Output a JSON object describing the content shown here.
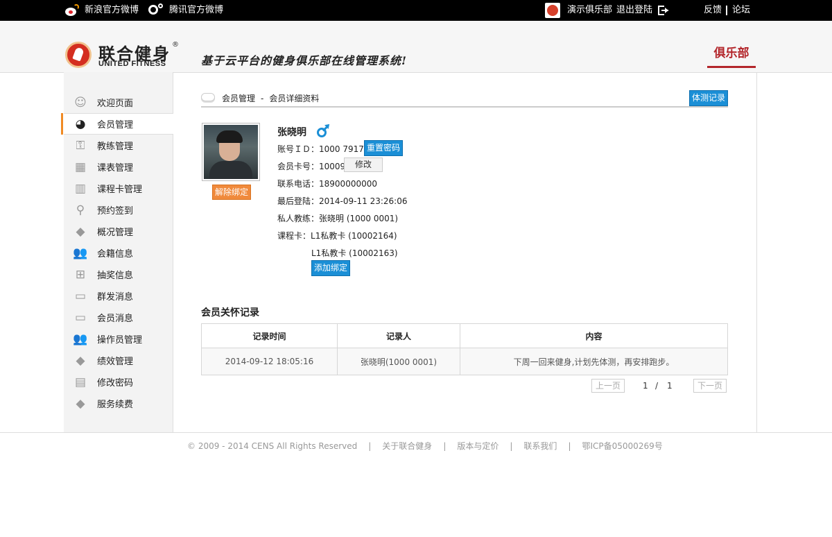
{
  "topbar": {
    "weibo": "新浪官方微博",
    "tencent": "腾讯官方微博",
    "club": "演示俱乐部",
    "logout": "退出登陆",
    "feedback": "反馈",
    "forum": "论坛"
  },
  "header": {
    "logo_cn": "联合健身",
    "logo_reg": "®",
    "logo_en": "UNITED FITNESS",
    "slogan": "基于云平台的健身俱乐部在线管理系统!",
    "tab": "俱乐部"
  },
  "sidebar": {
    "items": [
      {
        "label": "欢迎页面",
        "icon": "smile-icon"
      },
      {
        "label": "会员管理",
        "icon": "pacman-icon"
      },
      {
        "label": "教练管理",
        "icon": "lock-icon"
      },
      {
        "label": "课表管理",
        "icon": "calendar-icon"
      },
      {
        "label": "课程卡管理",
        "icon": "barcode-icon"
      },
      {
        "label": "预约签到",
        "icon": "location-pin-icon"
      },
      {
        "label": "概况管理",
        "icon": "diamond-icon"
      },
      {
        "label": "会籍信息",
        "icon": "users-icon"
      },
      {
        "label": "抽奖信息",
        "icon": "gift-icon"
      },
      {
        "label": "群发消息",
        "icon": "chat-icon"
      },
      {
        "label": "会员消息",
        "icon": "chat-icon"
      },
      {
        "label": "操作员管理",
        "icon": "users-icon"
      },
      {
        "label": "绩效管理",
        "icon": "diamond-icon"
      },
      {
        "label": "修改密码",
        "icon": "id-card-icon"
      },
      {
        "label": "服务续费",
        "icon": "diamond-icon"
      }
    ],
    "active_index": 1
  },
  "breadcrumb": {
    "level1": "会员管理",
    "separator": "-",
    "level2": "会员详细资料"
  },
  "body_test_button": "体测记录",
  "member": {
    "name": "张晓明",
    "unbind_button": "解除绑定",
    "account_label": "账号ＩＤ：",
    "account_value": "1000 7917",
    "reset_password_button": "重置密码",
    "card_label": "会员卡号：",
    "card_value": "10009",
    "modify_button": "修改",
    "phone_label": "联系电话：",
    "phone_value": "18900000000",
    "last_login_label": "最后登陆：",
    "last_login_value": "2014-09-11 23:26:06",
    "trainer_label": "私人教练：",
    "trainer_value": "张晓明 (1000 0001)",
    "course_label": "课程卡：",
    "courses": [
      "L1私教卡 (10002164)",
      "L1私教卡 (10002163)"
    ],
    "add_bind_button": "添加绑定"
  },
  "care": {
    "title": "会员关怀记录",
    "columns": [
      "记录时间",
      "记录人",
      "内容"
    ],
    "rows": [
      [
        "2014-09-12 18:05:16",
        "张晓明(1000 0001)",
        "下周一回来健身,计划先体测，再安排跑步。"
      ]
    ]
  },
  "pager": {
    "prev": "上一页",
    "current": "1",
    "slash": "/",
    "total": "1",
    "next": "下一页"
  },
  "footer": {
    "copyright": "© 2009 - 2014 CENS All Rights Reserved",
    "sep": "|",
    "about": "关于联合健身",
    "pricing": "版本与定价",
    "contact": "联系我们",
    "icp": "鄂ICP备05000269号"
  }
}
